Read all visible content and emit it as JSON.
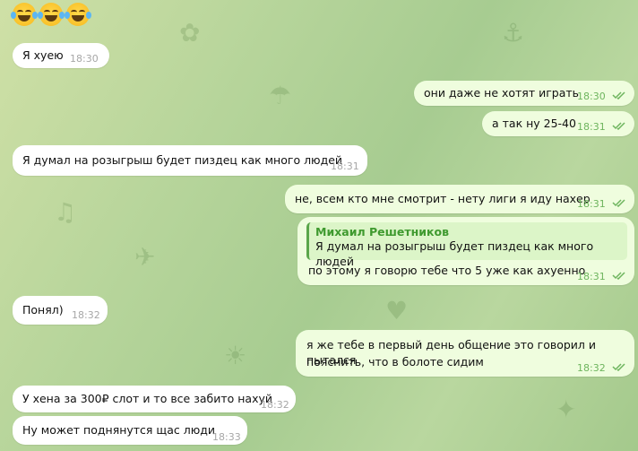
{
  "chat": {
    "emoji": {
      "icon": "rolling-on-floor-laughing-emoji",
      "count": 3
    },
    "messages": [
      {
        "text": "Я хуею",
        "time": "18:30",
        "dir": "in"
      },
      {
        "text": "они даже не хотят играть",
        "time": "18:30",
        "dir": "out",
        "status": "read"
      },
      {
        "text": "а так ну 25-40",
        "time": "18:31",
        "dir": "out",
        "status": "read"
      },
      {
        "text": "Я думал на розыгрыш будет пиздец как много людей",
        "time": "18:31",
        "dir": "in"
      },
      {
        "text": "не, всем кто мне смотрит - нету лиги я иду нахер",
        "time": "18:31",
        "dir": "out",
        "status": "read"
      },
      {
        "reply_name": "Михаил Решетников",
        "reply_text": "Я думал на розыгрыш будет пиздец как много людей",
        "text": "по этому я говорю тебе что 5 уже как ахуенно",
        "time": "18:31",
        "dir": "out",
        "status": "read"
      },
      {
        "text": "Понял)",
        "time": "18:32",
        "dir": "in"
      },
      {
        "text_line1": "я же тебе в первый день общение это говорил и пытался",
        "text_line2": "пояснить, что в болоте сидим",
        "time": "18:32",
        "dir": "out",
        "status": "read"
      },
      {
        "text": "У хена за 300₽ слот и то все забито нахуй",
        "time": "18:32",
        "dir": "in"
      },
      {
        "text": "Ну может поднянутся щас люди",
        "time": "18:33",
        "dir": "in"
      }
    ]
  },
  "colors": {
    "incoming": "#ffffff",
    "outgoing": "#effdde",
    "read_check": "#6eb55e",
    "reply_accent": "#5aa64a"
  }
}
